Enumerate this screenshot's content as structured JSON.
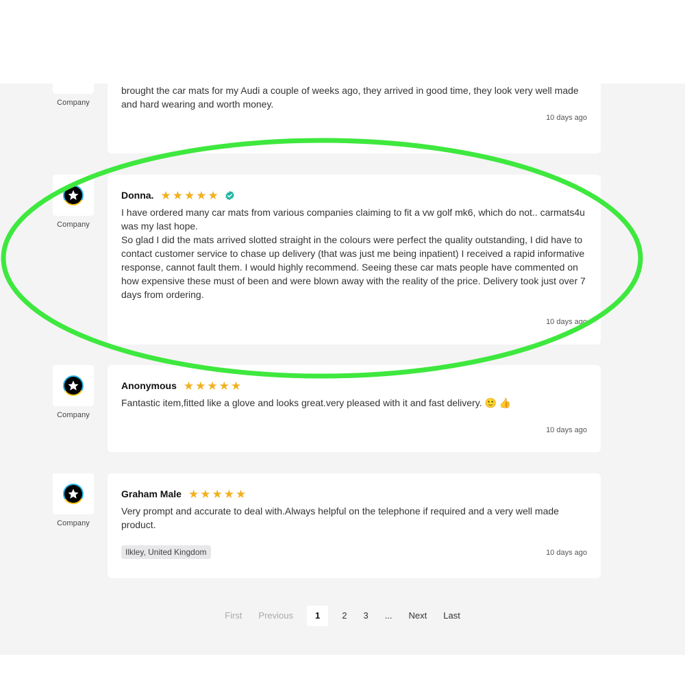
{
  "reviews": [
    {
      "company_label": "Company",
      "text": "brought the car mats for my Audi a couple of weeks ago, they arrived in good time, they look very well made and hard wearing and worth money.",
      "time": "10 days ago"
    },
    {
      "company_label": "Company",
      "name": "Donna.",
      "rating": 5,
      "verified": true,
      "text_p1": "I have ordered many car mats from various companies claiming to fit a vw golf mk6, which do not.. carmats4u was my last hope.",
      "text_p2": "So glad I did the mats arrived slotted straight in the colours were perfect the quality outstanding, I did have to contact customer service to chase up delivery (that was just me being inpatient) I received a rapid informative response, cannot fault them. I would highly recommend. Seeing these car mats people have commented on how expensive these must of been and were blown away with the reality of the price. Delivery took just over 7 days from ordering.",
      "time": "10 days ago"
    },
    {
      "company_label": "Company",
      "name": "Anonymous",
      "rating": 5,
      "text": "Fantastic item,fitted like a glove and looks great.very pleased with it and fast delivery. 🙂 👍",
      "time": "10 days ago"
    },
    {
      "company_label": "Company",
      "name": "Graham Male",
      "rating": 5,
      "text": "Very prompt and accurate to deal with.Always helpful on the telephone if required and a very well made product.",
      "location": "Ilkley, United Kingdom",
      "time": "10 days ago"
    }
  ],
  "pagination": {
    "first": "First",
    "previous": "Previous",
    "pages": [
      "1",
      "2",
      "3"
    ],
    "ellipsis": "...",
    "next": "Next",
    "last": "Last",
    "current": "1"
  },
  "colors": {
    "star": "#f2b01e",
    "verified": "#1fb6a3",
    "annotation": "#3ee83e",
    "background": "#f4f4f5"
  },
  "icons": {
    "avatar": "star-badge-icon",
    "rating": "star-icon",
    "verified": "verified-check-icon"
  }
}
